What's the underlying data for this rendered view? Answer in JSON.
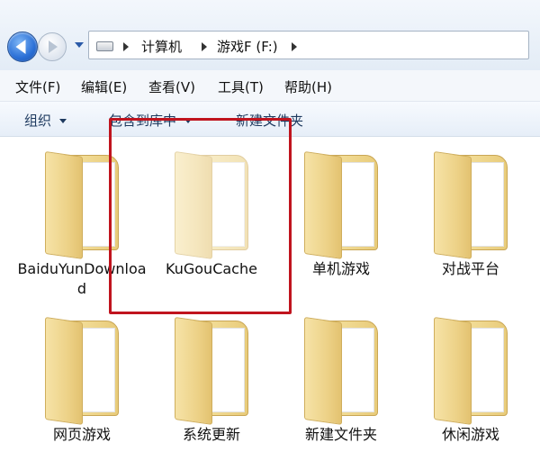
{
  "address_bar": {
    "breadcrumbs": [
      "计算机",
      "游戏F (F:)"
    ]
  },
  "menu": {
    "items": [
      "文件(F)",
      "编辑(E)",
      "查看(V)",
      "工具(T)",
      "帮助(H)"
    ]
  },
  "command_bar": {
    "organize": "组织",
    "include_in_library": "包含到库中",
    "new_folder": "新建文件夹"
  },
  "folders": [
    {
      "name": "BaiduYunDownload",
      "selected": false
    },
    {
      "name": "KuGouCache",
      "selected": false,
      "hidden_style": true
    },
    {
      "name": "单机游戏",
      "selected": false
    },
    {
      "name": "对战平台",
      "selected": false
    },
    {
      "name": "网页游戏",
      "selected": false
    },
    {
      "name": "系统更新",
      "selected": false
    },
    {
      "name": "新建文件夹",
      "selected": false
    },
    {
      "name": "休闲游戏",
      "selected": false
    }
  ],
  "colors": {
    "highlight_border": "#c0141e",
    "folder_yellow": "#edd288"
  }
}
